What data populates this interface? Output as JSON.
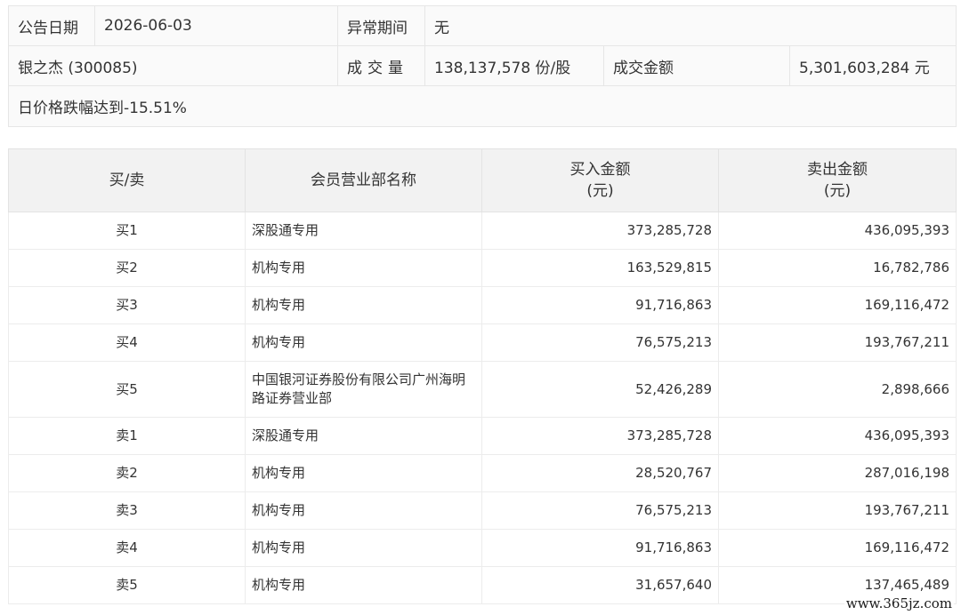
{
  "info": {
    "date_label": "公告日期",
    "date_value": "2026-06-03",
    "abnormal_label": "异常期间",
    "abnormal_value": "无",
    "stock": "银之杰 (300085)",
    "volume_label": "成交量",
    "volume_value": "138,137,578 份/股",
    "amount_label": "成交金额",
    "amount_value": "5,301,603,284 元",
    "reason": "日价格跌幅达到-15.51%"
  },
  "table": {
    "headers": [
      "买/卖",
      "会员营业部名称",
      "买入金额\n(元)",
      "卖出金额\n(元)"
    ],
    "rows": [
      {
        "side": "买1",
        "dept": "深股通专用",
        "buy": "373,285,728",
        "sell": "436,095,393"
      },
      {
        "side": "买2",
        "dept": "机构专用",
        "buy": "163,529,815",
        "sell": "16,782,786"
      },
      {
        "side": "买3",
        "dept": "机构专用",
        "buy": "91,716,863",
        "sell": "169,116,472"
      },
      {
        "side": "买4",
        "dept": "机构专用",
        "buy": "76,575,213",
        "sell": "193,767,211"
      },
      {
        "side": "买5",
        "dept": "中国银河证券股份有限公司广州海明路证券营业部",
        "buy": "52,426,289",
        "sell": "2,898,666"
      },
      {
        "side": "卖1",
        "dept": "深股通专用",
        "buy": "373,285,728",
        "sell": "436,095,393"
      },
      {
        "side": "卖2",
        "dept": "机构专用",
        "buy": "28,520,767",
        "sell": "287,016,198"
      },
      {
        "side": "卖3",
        "dept": "机构专用",
        "buy": "76,575,213",
        "sell": "193,767,211"
      },
      {
        "side": "卖4",
        "dept": "机构专用",
        "buy": "91,716,863",
        "sell": "169,116,472"
      },
      {
        "side": "卖5",
        "dept": "机构专用",
        "buy": "31,657,640",
        "sell": "137,465,489"
      }
    ]
  },
  "watermark": "www.365jz.com"
}
